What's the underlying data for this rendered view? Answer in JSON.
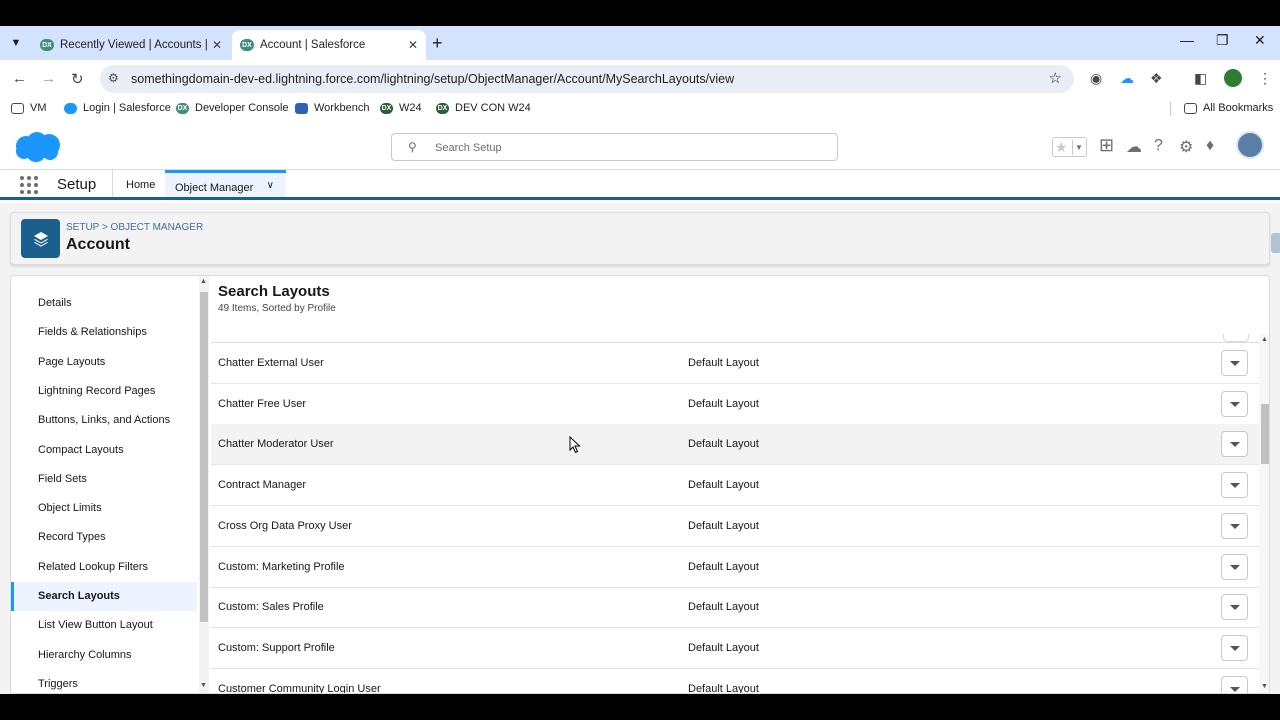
{
  "browser": {
    "tabs": [
      {
        "title": "Recently Viewed | Accounts | Sa",
        "active": false
      },
      {
        "title": "Account | Salesforce",
        "active": true
      }
    ],
    "url": "somethingdomain-dev-ed.lightning.force.com/lightning/setup/ObjectManager/Account/MySearchLayouts/view",
    "bookmarks": [
      {
        "label": "VM",
        "icon": "folder-icon"
      },
      {
        "label": "Login | Salesforce",
        "icon": "salesforce-cloud-icon"
      },
      {
        "label": "Developer Console",
        "icon": "dx-icon"
      },
      {
        "label": "Workbench",
        "icon": "cube-icon"
      },
      {
        "label": "W24",
        "icon": "dx-icon"
      },
      {
        "label": "DEV CON W24",
        "icon": "dx-icon"
      }
    ],
    "all_bookmarks": "All Bookmarks"
  },
  "header": {
    "search_placeholder": "Search Setup"
  },
  "setup_nav": {
    "title": "Setup",
    "home": "Home",
    "object_manager": "Object Manager"
  },
  "object": {
    "breadcrumb": "SETUP > OBJECT MANAGER",
    "title": "Account"
  },
  "sidebar": {
    "items": [
      {
        "label": "Details"
      },
      {
        "label": "Fields & Relationships"
      },
      {
        "label": "Page Layouts"
      },
      {
        "label": "Lightning Record Pages"
      },
      {
        "label": "Buttons, Links, and Actions"
      },
      {
        "label": "Compact Layouts"
      },
      {
        "label": "Field Sets"
      },
      {
        "label": "Object Limits"
      },
      {
        "label": "Record Types"
      },
      {
        "label": "Related Lookup Filters"
      },
      {
        "label": "Search Layouts"
      },
      {
        "label": "List View Button Layout"
      },
      {
        "label": "Hierarchy Columns"
      },
      {
        "label": "Triggers"
      }
    ],
    "active_index": 10
  },
  "main": {
    "title": "Search Layouts",
    "subtitle": "49 Items, Sorted by Profile",
    "rows": [
      {
        "profile": "Chatter External User",
        "layout": "Default Layout"
      },
      {
        "profile": "Chatter Free User",
        "layout": "Default Layout"
      },
      {
        "profile": "Chatter Moderator User",
        "layout": "Default Layout"
      },
      {
        "profile": "Contract Manager",
        "layout": "Default Layout"
      },
      {
        "profile": "Cross Org Data Proxy User",
        "layout": "Default Layout"
      },
      {
        "profile": "Custom: Marketing Profile",
        "layout": "Default Layout"
      },
      {
        "profile": "Custom: Sales Profile",
        "layout": "Default Layout"
      },
      {
        "profile": "Custom: Support Profile",
        "layout": "Default Layout"
      },
      {
        "profile": "Customer Community Login User",
        "layout": "Default Layout"
      }
    ],
    "hover_index": 2
  },
  "colors": {
    "brand_blue": "#1b96ff",
    "setup_dark_blue": "#1b5f8c",
    "chrome_tab_bg": "#d3e3fd"
  }
}
